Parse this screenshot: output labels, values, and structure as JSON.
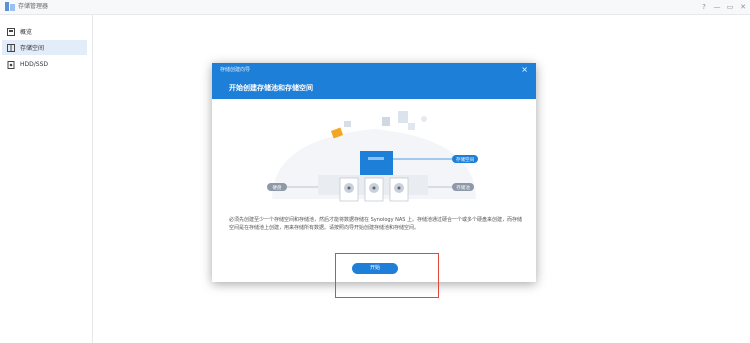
{
  "window": {
    "title": "存储管理器",
    "controls": [
      "?",
      "—",
      "▭",
      "✕"
    ]
  },
  "sidebar": {
    "items": [
      {
        "label": "概览",
        "icon": "overview-icon"
      },
      {
        "label": "存储空间",
        "icon": "storage-icon",
        "active": true
      },
      {
        "label": "HDD/SSD",
        "icon": "disk-icon"
      }
    ]
  },
  "dialog": {
    "small_title": "存储创建向导",
    "title": "开始创建存储池和存储空间",
    "close_label": "×",
    "illustration": {
      "label_storage_space": "存储空间",
      "label_pool": "存储池",
      "label_disk": "硬盘"
    },
    "description": "必须先创建至少一个存储空间和存储池，然后才能将数据存储在 Synology NAS 上。存储池通过硬合一个或多个硬盘来创建，而存储空间是在存储池上创建，用来存储所有数据。请按照向导开始创建存储池和存储空间。",
    "start_button": "开始"
  },
  "colors": {
    "accent": "#1e7fd8",
    "highlight": "#e0483a"
  }
}
